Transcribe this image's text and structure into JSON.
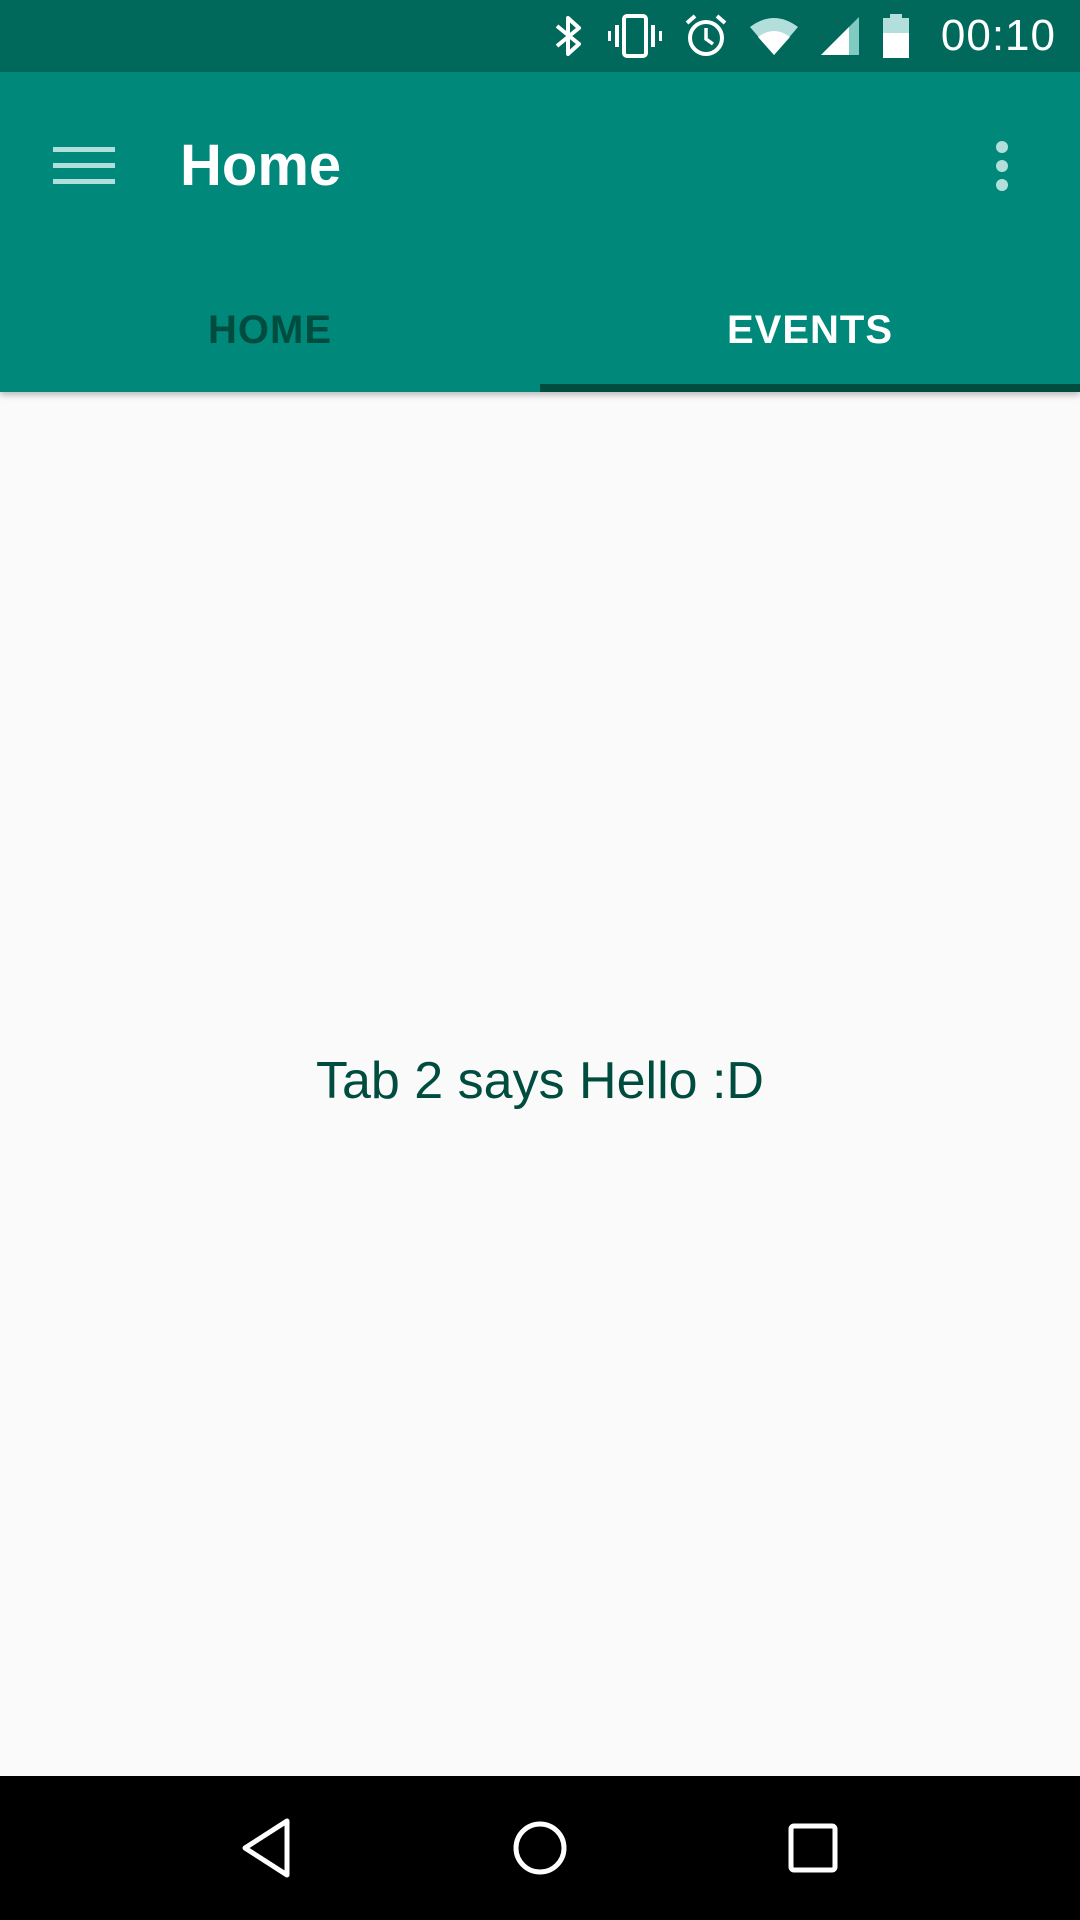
{
  "status_bar": {
    "time": "00:10",
    "icons": [
      "bluetooth-icon",
      "vibrate-icon",
      "alarm-icon",
      "wifi-icon",
      "signal-icon",
      "battery-icon"
    ]
  },
  "app_bar": {
    "title": "Home",
    "color": "#00897b",
    "status_color": "#00695c"
  },
  "tabs": [
    {
      "label": "HOME",
      "selected": false
    },
    {
      "label": "EVENTS",
      "selected": true
    }
  ],
  "content": {
    "message": "Tab 2 says Hello :D"
  },
  "nav_bar": {
    "buttons": [
      "back-icon",
      "home-icon",
      "recents-icon"
    ]
  }
}
